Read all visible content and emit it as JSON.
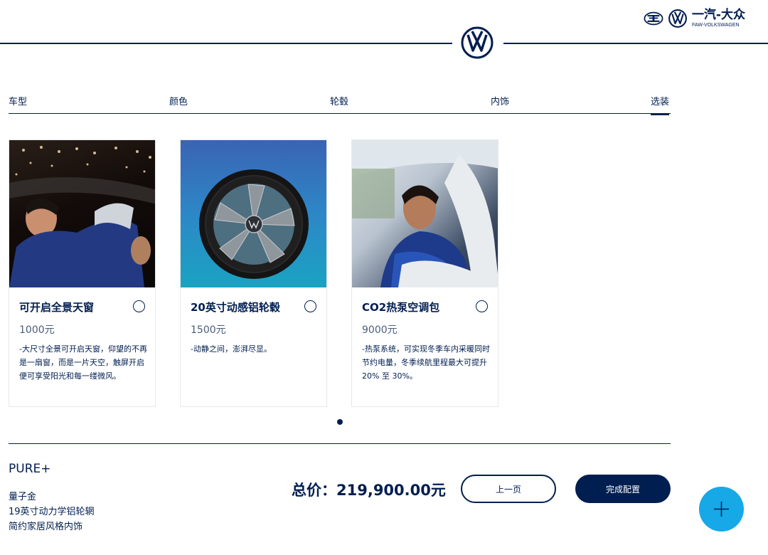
{
  "header": {
    "brand_cn": "一汽-大众",
    "brand_en": "FAW-VOLKSWAGEN",
    "logo_icon": "vw-logo-icon"
  },
  "tabs": [
    {
      "label": "车型",
      "active": false
    },
    {
      "label": "颜色",
      "active": false
    },
    {
      "label": "轮毂",
      "active": false
    },
    {
      "label": "内饰",
      "active": false
    },
    {
      "label": "选装",
      "active": true
    }
  ],
  "options": [
    {
      "title": "可开启全景天窗",
      "price": "1000元",
      "description": "-大尺寸全景可开启天窗，仰望的不再是一扇窗，而是一片天空，触屏开启便可享受阳光和每一缕微风。",
      "selected": false
    },
    {
      "title": "20英寸动感铝轮毂",
      "price": "1500元",
      "description": "-动静之间，澎湃尽显。",
      "selected": false
    },
    {
      "title": "CO2热泵空调包",
      "price": "9000元",
      "description": "-热泵系统，可实现冬季车内采暖同时节约电量，冬季续航里程最大可提升20% 至 30%。",
      "selected": false
    }
  ],
  "pagination": {
    "current": 1,
    "total": 1
  },
  "summary": {
    "model": "PURE+",
    "specs": [
      "量子金",
      "19英寸动力学铝轮辋",
      "简约家居风格内饰"
    ],
    "total_price": "总价：219,900.00元"
  },
  "buttons": {
    "prev": "上一页",
    "done": "完成配置"
  },
  "colors": {
    "brand_navy": "#001e50",
    "fab_blue": "#17a8e8"
  }
}
